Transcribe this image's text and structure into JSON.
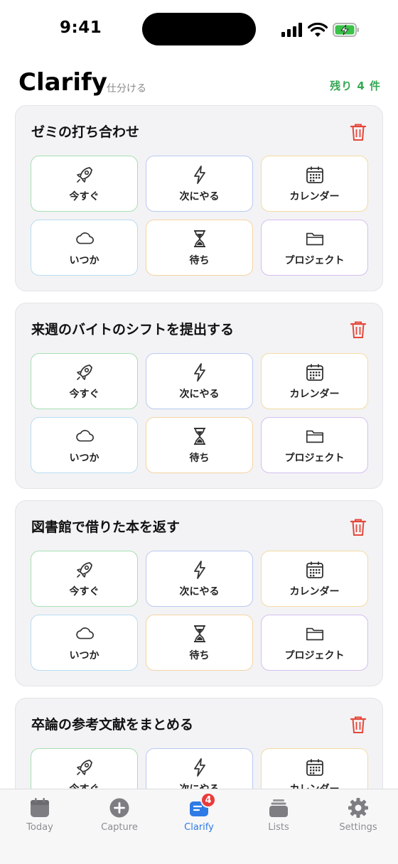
{
  "status_bar": {
    "time": "9:41"
  },
  "header": {
    "title": "Clarify",
    "subtitle": "仕分ける",
    "remaining": "残り 4 件"
  },
  "actions": {
    "now": "今すぐ",
    "next": "次にやる",
    "calendar": "カレンダー",
    "someday": "いつか",
    "waiting": "待ち",
    "project": "プロジェクト"
  },
  "items": [
    {
      "title": "ゼミの打ち合わせ"
    },
    {
      "title": "来週のバイトのシフトを提出する"
    },
    {
      "title": "図書館で借りた本を返す"
    },
    {
      "title": "卒論の参考文献をまとめる"
    }
  ],
  "tabs": [
    {
      "label": "Today"
    },
    {
      "label": "Capture"
    },
    {
      "label": "Clarify",
      "badge": "4"
    },
    {
      "label": "Lists"
    },
    {
      "label": "Settings"
    }
  ],
  "colors": {
    "accent": "#2f7ae5",
    "remaining": "#34a853",
    "trash": "#e5483b",
    "badge": "#ea3b3b"
  }
}
